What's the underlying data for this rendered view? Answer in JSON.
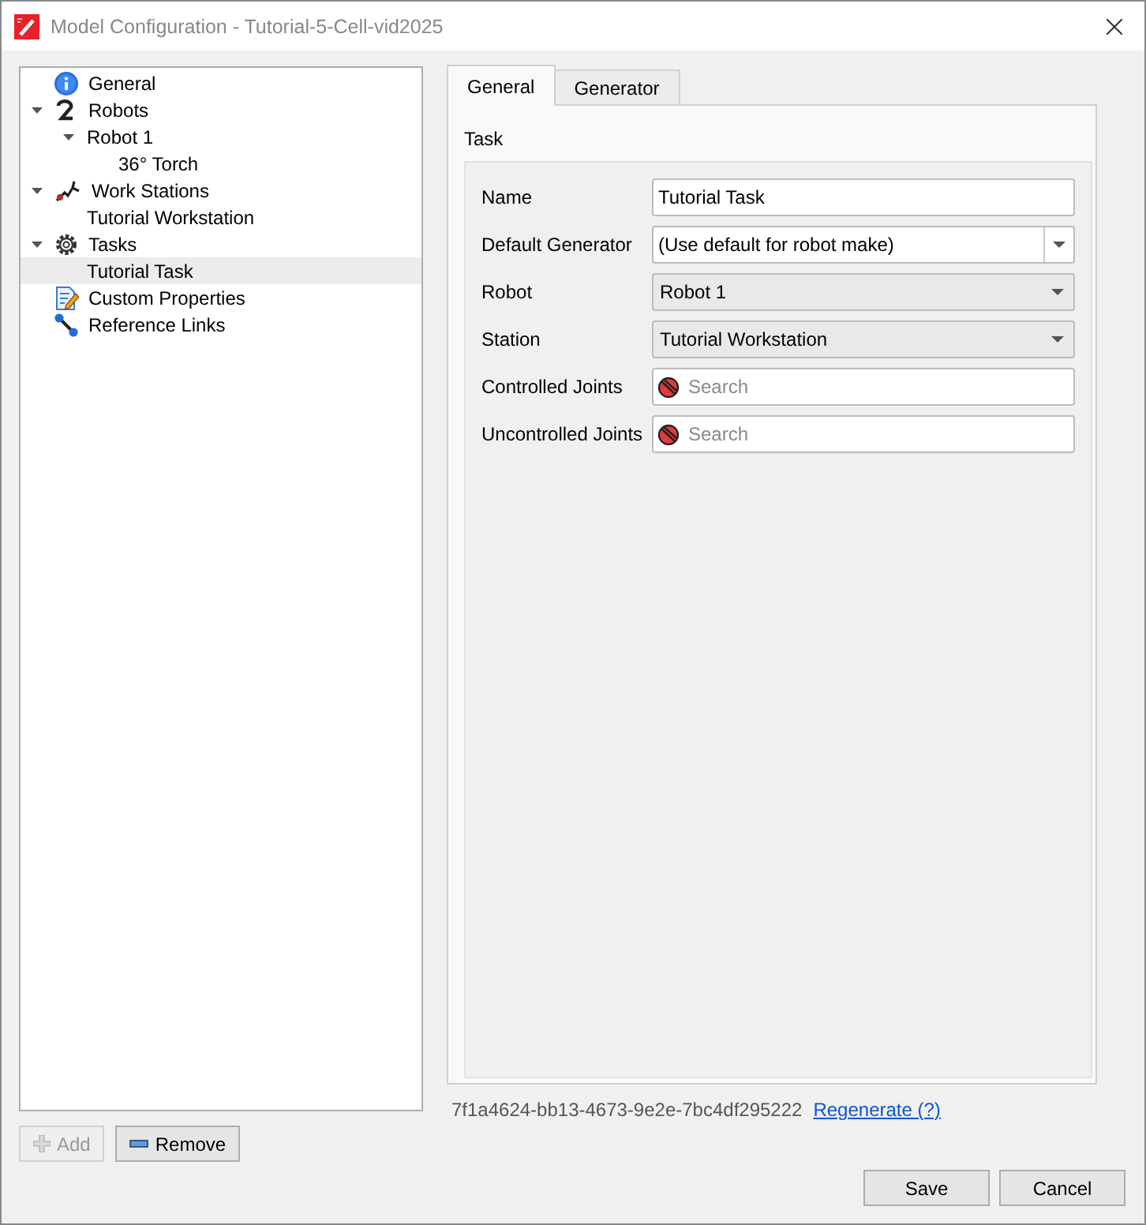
{
  "window": {
    "title": "Model Configuration - Tutorial-5-Cell-vid2025"
  },
  "tree": [
    {
      "label": "General",
      "kind": "info",
      "selected": false
    },
    {
      "label": "Robots",
      "kind": "robot",
      "selected": false,
      "expanded": true,
      "children": [
        {
          "label": "Robot 1",
          "selected": false,
          "expanded": true,
          "children": [
            {
              "label": "36° Torch",
              "selected": false
            }
          ]
        }
      ]
    },
    {
      "label": "Work Stations",
      "kind": "station",
      "selected": false,
      "expanded": true,
      "children": [
        {
          "label": "Tutorial Workstation",
          "selected": false
        }
      ]
    },
    {
      "label": "Tasks",
      "kind": "gear",
      "selected": false,
      "expanded": true,
      "children": [
        {
          "label": "Tutorial Task",
          "selected": true
        }
      ]
    },
    {
      "label": "Custom Properties",
      "kind": "properties",
      "selected": false
    },
    {
      "label": "Reference Links",
      "kind": "links",
      "selected": false
    }
  ],
  "tree_buttons": [
    {
      "label": "Add",
      "kind": "add",
      "disabled": true
    },
    {
      "label": "Remove",
      "kind": "remove",
      "disabled": false
    }
  ],
  "tabs": [
    {
      "label": "General",
      "selected": true
    },
    {
      "label": "Generator",
      "selected": false
    }
  ],
  "group": {
    "title": "Task"
  },
  "fields": [
    {
      "label": "Name",
      "kind": "text",
      "value": "Tutorial Task"
    },
    {
      "label": "Default Generator",
      "kind": "editable-combo",
      "value": "(Use default for robot make)"
    },
    {
      "label": "Robot",
      "kind": "combo",
      "value": "Robot 1"
    },
    {
      "label": "Station",
      "kind": "combo",
      "value": "Tutorial Workstation"
    },
    {
      "label": "Controlled Joints",
      "kind": "search",
      "placeholder": "Search"
    },
    {
      "label": "Uncontrolled Joints",
      "kind": "search",
      "placeholder": "Search"
    }
  ],
  "id_text": "7f1a4624-bb13-4673-9e2e-7bc4df295222",
  "regenerate_link": "Regenerate (?)",
  "buttons": [
    "Save",
    "Cancel"
  ]
}
